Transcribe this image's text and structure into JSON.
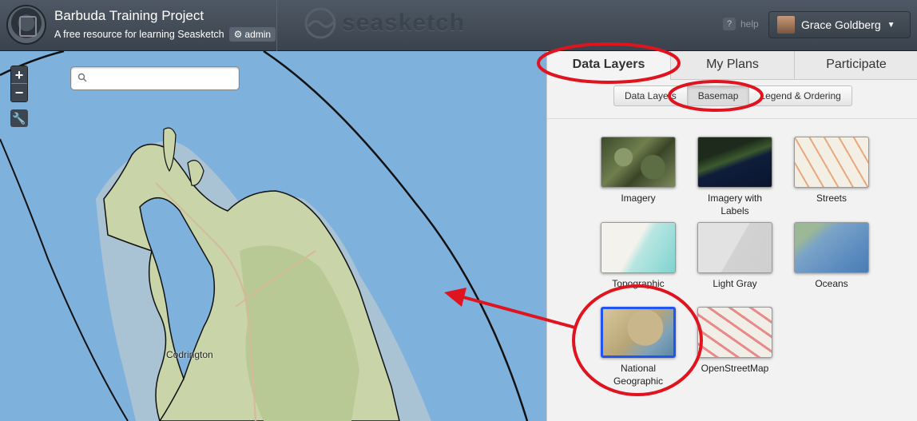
{
  "header": {
    "project_title": "Barbuda Training Project",
    "project_subtitle": "A free resource for learning Seasketch",
    "admin_label": "admin",
    "brand": "seasketch",
    "help_label": "help",
    "user_name": "Grace Goldberg"
  },
  "map": {
    "search_placeholder": "",
    "zoom_in": "+",
    "zoom_out": "−",
    "place_label": "Codrington"
  },
  "panel": {
    "tabs": [
      {
        "label": "Data Layers"
      },
      {
        "label": "My Plans"
      },
      {
        "label": "Participate"
      }
    ],
    "subtabs": [
      {
        "label": "Data Layers"
      },
      {
        "label": "Basemap"
      },
      {
        "label": "Legend & Ordering"
      }
    ],
    "basemaps": [
      {
        "label": "Imagery"
      },
      {
        "label": "Imagery with Labels"
      },
      {
        "label": "Streets"
      },
      {
        "label": "Topographic"
      },
      {
        "label": "Light Gray"
      },
      {
        "label": "Oceans"
      },
      {
        "label": "National Geographic",
        "selected": true
      },
      {
        "label": "OpenStreetMap"
      }
    ]
  },
  "colors": {
    "annotation": "#e0141e",
    "selected_border": "#2255ee",
    "water": "#7eb1dc",
    "land": "#c9d4a8"
  }
}
